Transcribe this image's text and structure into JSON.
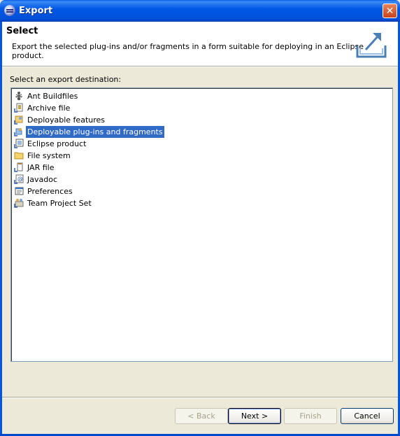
{
  "window": {
    "title": "Export"
  },
  "header": {
    "title": "Select",
    "description": "Export the selected plug-ins and/or fragments in a form suitable for deploying in an Eclipse product."
  },
  "prompt": "Select an export destination:",
  "destinations": [
    {
      "label": "Ant Buildfiles",
      "icon": "ant-icon"
    },
    {
      "label": "Archive file",
      "icon": "archive-file-icon"
    },
    {
      "label": "Deployable features",
      "icon": "deployable-features-icon"
    },
    {
      "label": "Deployable plug-ins and fragments",
      "icon": "plugin-icon",
      "selected": true
    },
    {
      "label": "Eclipse product",
      "icon": "eclipse-product-icon"
    },
    {
      "label": "File system",
      "icon": "folder-icon"
    },
    {
      "label": "JAR file",
      "icon": "jar-file-icon"
    },
    {
      "label": "Javadoc",
      "icon": "javadoc-icon"
    },
    {
      "label": "Preferences",
      "icon": "preferences-icon"
    },
    {
      "label": "Team Project Set",
      "icon": "team-project-set-icon"
    }
  ],
  "buttons": {
    "back": "< Back",
    "next": "Next >",
    "finish": "Finish",
    "cancel": "Cancel"
  },
  "colors": {
    "selection": "#316ac5",
    "titlebar": "#0058e6",
    "dialog_bg": "#ece9d8"
  }
}
